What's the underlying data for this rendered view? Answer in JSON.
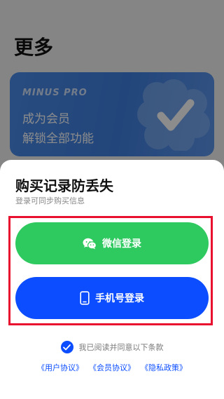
{
  "background_page": {
    "title": "更多",
    "vip_card": {
      "brand": "MINUS PRO",
      "line1": "成为会员",
      "line2": "解锁全部功能"
    }
  },
  "sheet": {
    "title": "购买记录防丢失",
    "subtitle": "登录可同步购买信息",
    "wechat_button_label": "微信登录",
    "phone_button_label": "手机号登录",
    "agreement_text": "我已阅读并同意以下条款",
    "links": [
      "《用户协议》",
      "《会员协议》",
      "《隐私政策》"
    ]
  },
  "colors": {
    "wechat_green": "#2fca5f",
    "phone_blue": "#0c4eff",
    "highlight_red": "#e8102e"
  }
}
